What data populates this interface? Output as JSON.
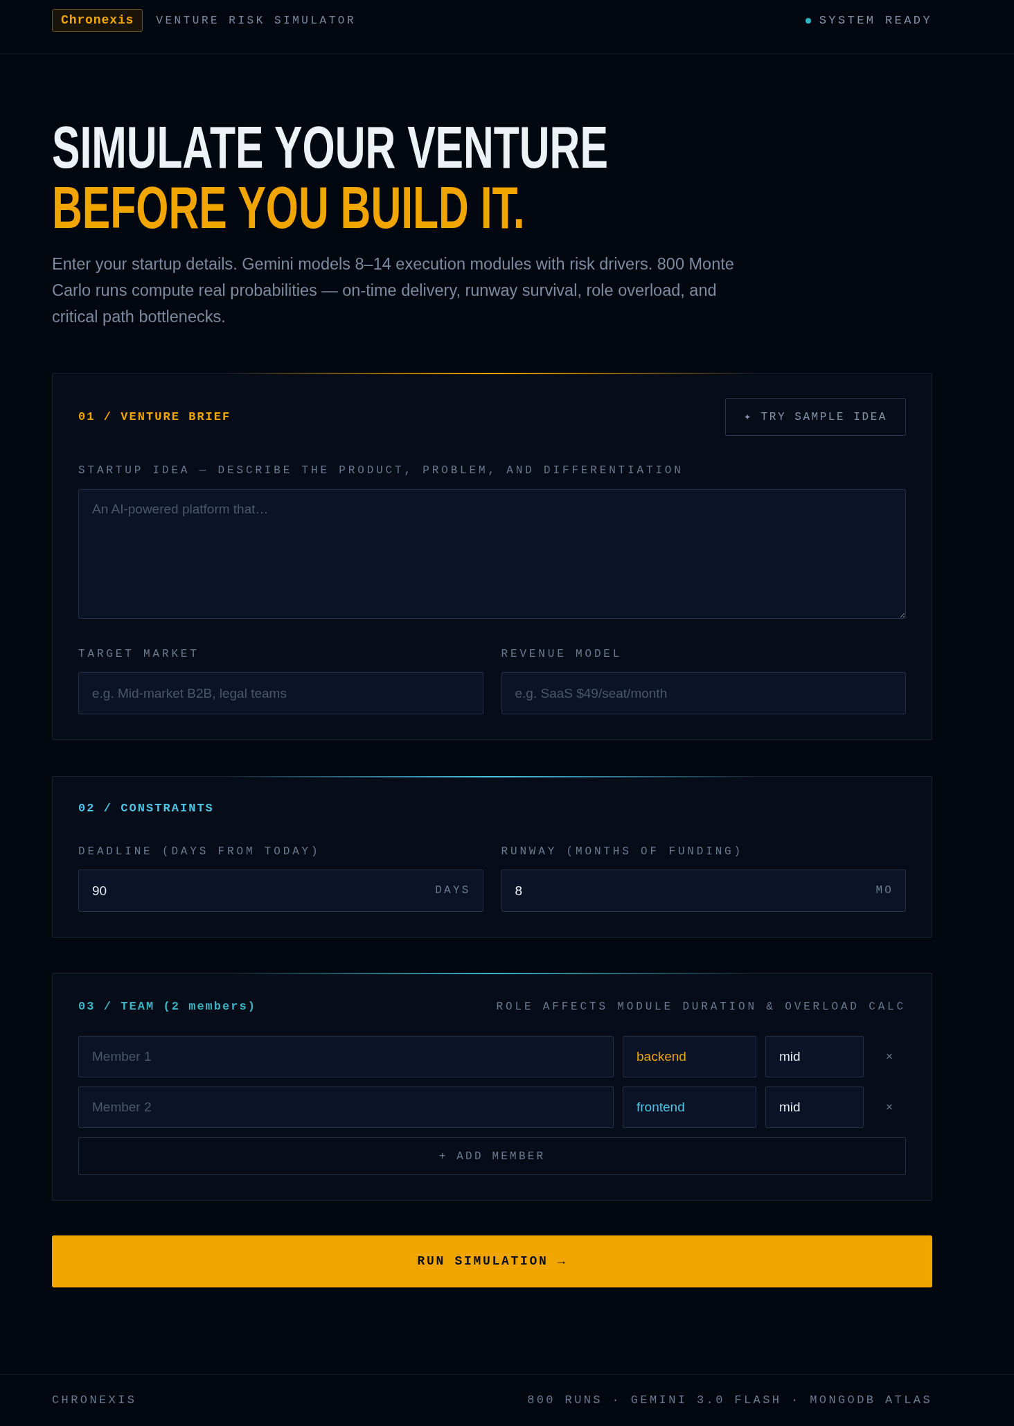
{
  "header": {
    "logo": "Chronexis",
    "title": "VENTURE RISK SIMULATOR",
    "status": {
      "label": "SYSTEM READY",
      "ready": true
    }
  },
  "hero": {
    "title": "SIMULATE YOUR VENTURE",
    "title_accent": "BEFORE YOU BUILD IT.",
    "description": "Enter your startup details. Gemini models 8–14 execution modules with risk drivers. 800 Monte Carlo runs compute real probabilities — on-time delivery, runway survival, role overload, and critical path bottlenecks."
  },
  "brief": {
    "title": "01 / VENTURE BRIEF",
    "color": "#f0a500",
    "sample_button": "✦ TRY SAMPLE IDEA",
    "idea": {
      "label": "STARTUP IDEA — DESCRIBE THE PRODUCT, PROBLEM, AND DIFFERENTIATION",
      "placeholder": "An AI-powered platform that…"
    },
    "fields": [
      {
        "label": "TARGET MARKET",
        "placeholder": "e.g. Mid-market B2B, legal teams"
      },
      {
        "label": "REVENUE MODEL",
        "placeholder": "e.g. SaaS $49/seat/month"
      }
    ]
  },
  "constraints": {
    "title": "02 / CONSTRAINTS",
    "color": "#4cc4e4",
    "fields": [
      {
        "label": "DEADLINE (DAYS FROM TODAY)",
        "value": "90",
        "unit": "DAYS"
      },
      {
        "label": "RUNWAY (MONTHS OF FUNDING)",
        "value": "8",
        "unit": "MO"
      }
    ]
  },
  "team": {
    "title": "03 / TEAM (2 members)",
    "color": "#3bb3c3",
    "note": "ROLE AFFECTS MODULE DURATION & OVERLOAD CALC",
    "members": [
      {
        "placeholder": "Member 1",
        "role": "backend",
        "color": "#f0a500",
        "seniority": "mid",
        "remove": "×"
      },
      {
        "placeholder": "Member 2",
        "role": "frontend",
        "color": "#4cc4e4",
        "seniority": "mid",
        "remove": "×"
      }
    ],
    "add_button": "+ ADD MEMBER"
  },
  "run_button": "RUN SIMULATION →",
  "footer": {
    "brand": "CHRONEXIS",
    "meta": "800 RUNS · GEMINI 3.0 FLASH · MONGODB ATLAS"
  }
}
